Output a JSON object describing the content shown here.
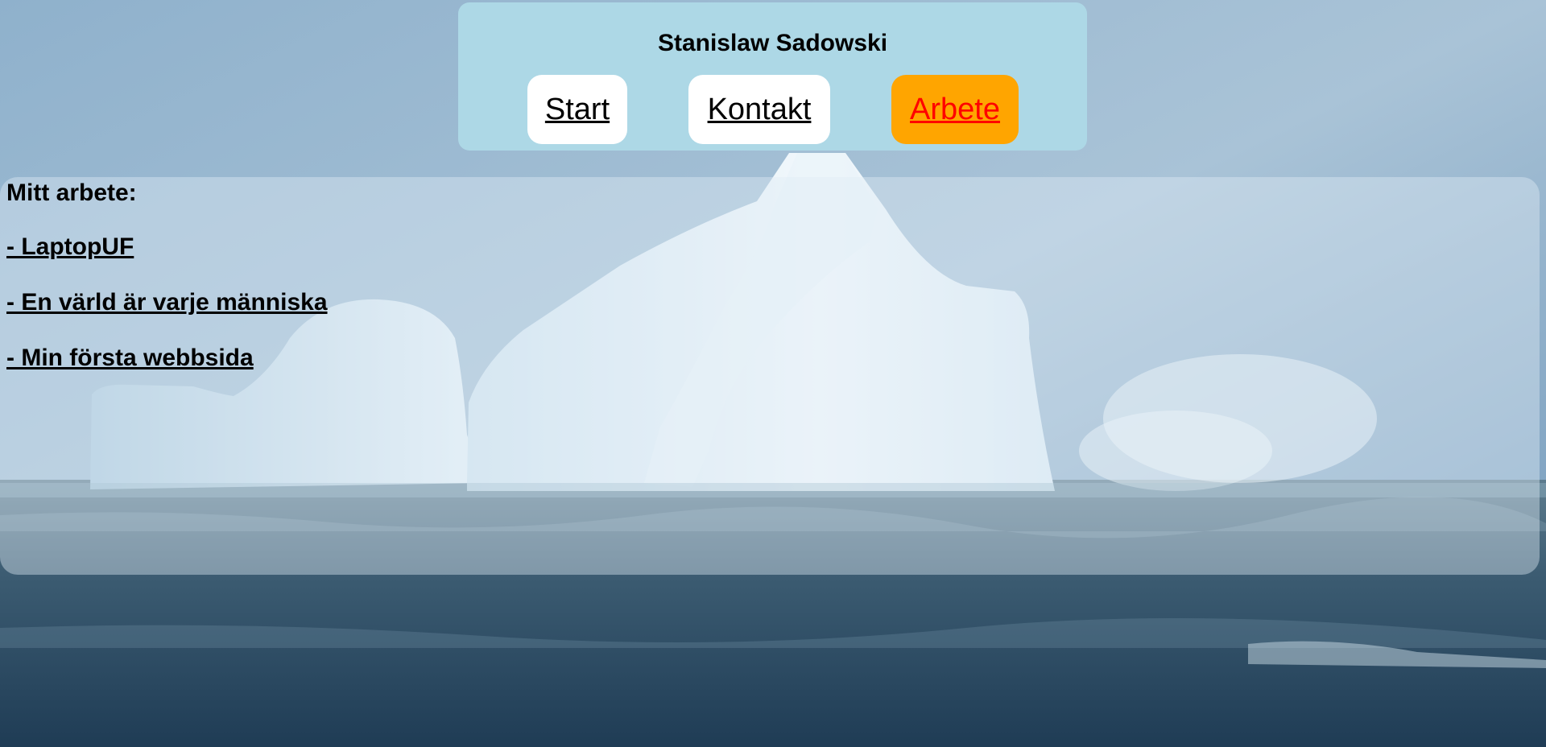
{
  "header": {
    "site_title": "Stanislaw Sadowski",
    "nav": [
      {
        "label": "Start",
        "active": false
      },
      {
        "label": "Kontakt",
        "active": false
      },
      {
        "label": "Arbete",
        "active": true
      }
    ]
  },
  "main": {
    "heading": "Mitt arbete:",
    "links": [
      {
        "label": "- LaptopUF"
      },
      {
        "label": "- En värld är varje människa"
      },
      {
        "label": "- Min första webbsida"
      }
    ]
  },
  "colors": {
    "header_background": "#add8e6",
    "button_background": "#ffffff",
    "active_button_background": "#ffa500",
    "active_button_text": "#ff0000"
  }
}
